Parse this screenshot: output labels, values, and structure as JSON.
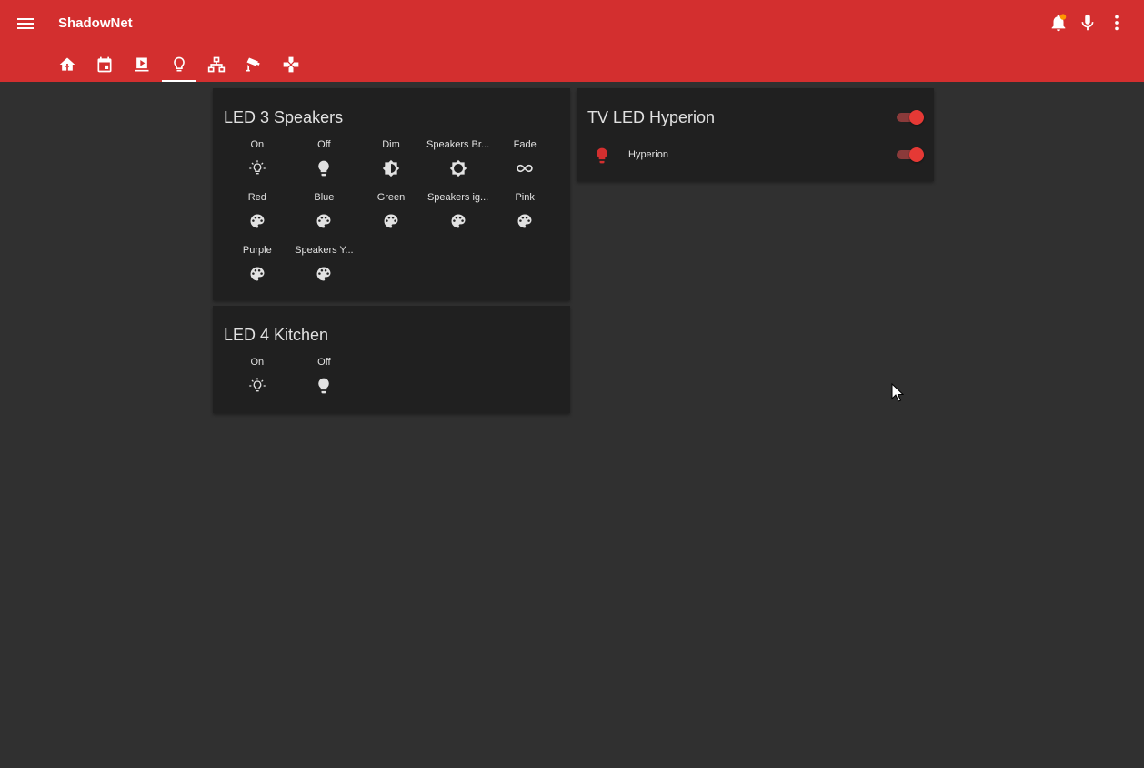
{
  "header": {
    "title": "ShadowNet",
    "tabs": [
      {
        "icon": "home-assistant-icon"
      },
      {
        "icon": "calendar-icon"
      },
      {
        "icon": "media-play-icon"
      },
      {
        "icon": "lightbulb-outline-icon",
        "active": true
      },
      {
        "icon": "network-icon"
      },
      {
        "icon": "cctv-camera-icon"
      },
      {
        "icon": "gamepad-icon"
      }
    ],
    "actions": [
      {
        "icon": "bell-icon",
        "badge_color": "#ff9800"
      },
      {
        "icon": "microphone-icon"
      },
      {
        "icon": "more-vertical-icon"
      }
    ]
  },
  "cards": {
    "led3": {
      "title": "LED 3 Speakers",
      "buttons": [
        {
          "label": "On",
          "icon": "lightbulb-on-outline-icon"
        },
        {
          "label": "Off",
          "icon": "lightbulb-icon"
        },
        {
          "label": "Dim",
          "icon": "brightness-medium-icon"
        },
        {
          "label": "Speakers Br...",
          "icon": "brightness-high-icon"
        },
        {
          "label": "Fade",
          "icon": "infinity-icon"
        },
        {
          "label": "Red",
          "icon": "palette-icon"
        },
        {
          "label": "Blue",
          "icon": "palette-icon"
        },
        {
          "label": "Green",
          "icon": "palette-icon"
        },
        {
          "label": "Speakers ig...",
          "icon": "palette-icon"
        },
        {
          "label": "Pink",
          "icon": "palette-icon"
        },
        {
          "label": "Purple",
          "icon": "palette-icon"
        },
        {
          "label": "Speakers Y...",
          "icon": "palette-icon"
        }
      ]
    },
    "led4": {
      "title": "LED 4 Kitchen",
      "buttons": [
        {
          "label": "On",
          "icon": "lightbulb-on-outline-icon"
        },
        {
          "label": "Off",
          "icon": "lightbulb-icon"
        }
      ]
    },
    "tv": {
      "title": "TV LED Hyperion",
      "master_toggle": {
        "state": "on"
      },
      "entities": [
        {
          "label": "Hyperion",
          "icon": "lightbulb-icon",
          "icon_color": "#d32f2f",
          "state": "on"
        }
      ]
    }
  },
  "colors": {
    "primary": "#d32f2f",
    "background": "#303030",
    "card": "#202020",
    "text": "#e1e1e1",
    "toggle_on": "#e53935"
  }
}
